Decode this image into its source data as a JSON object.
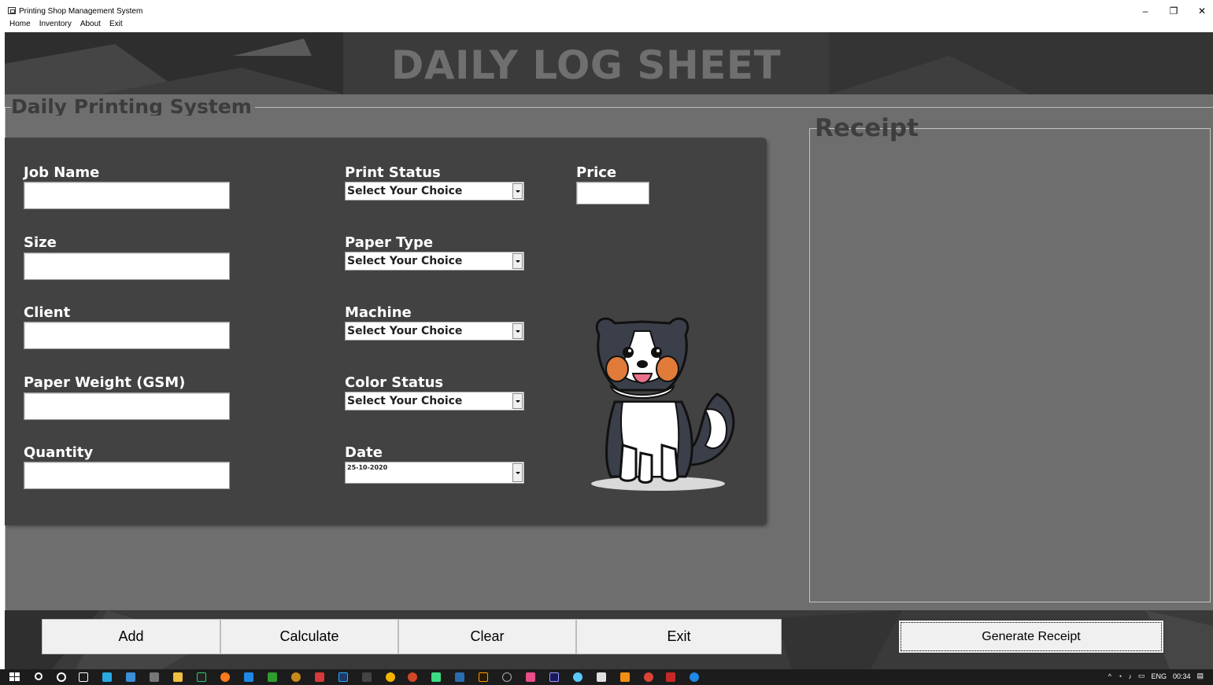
{
  "window": {
    "title": "Printing Shop Management System",
    "controls": {
      "minimize": "–",
      "restore": "❐",
      "close": "✕"
    }
  },
  "menu": [
    "Home",
    "Inventory",
    "About",
    "Exit"
  ],
  "banner": {
    "title": "DAILY LOG SHEET"
  },
  "section": {
    "title": "Daily Printing System"
  },
  "form": {
    "job_name": {
      "label": "Job Name",
      "value": ""
    },
    "size": {
      "label": "Size",
      "value": ""
    },
    "client": {
      "label": "Client",
      "value": ""
    },
    "paper_weight": {
      "label": "Paper Weight (GSM)",
      "value": ""
    },
    "quantity": {
      "label": "Quantity",
      "value": ""
    },
    "print_status": {
      "label": "Print Status",
      "value": "Select Your Choice"
    },
    "paper_type": {
      "label": "Paper Type",
      "value": "Select Your Choice"
    },
    "machine": {
      "label": "Machine",
      "value": "Select Your Choice"
    },
    "color_status": {
      "label": "Color Status",
      "value": "Select Your Choice"
    },
    "date": {
      "label": "Date",
      "value": "25-10-2020"
    },
    "price": {
      "label": "Price",
      "value": ""
    }
  },
  "receipt": {
    "title": "Receipt",
    "content": ""
  },
  "buttons": {
    "add": "Add",
    "calculate": "Calculate",
    "clear": "Clear",
    "exit": "Exit",
    "generate_receipt": "Generate Receipt"
  },
  "taskbar": {
    "tray": {
      "language": "ENG",
      "time": "00:34"
    }
  },
  "colors": {
    "frame_bg": "#6e6e6e",
    "panel_bg": "#424242",
    "banner_bg": "#3a3a3a",
    "taskbar_bg": "#1c1c1c"
  }
}
